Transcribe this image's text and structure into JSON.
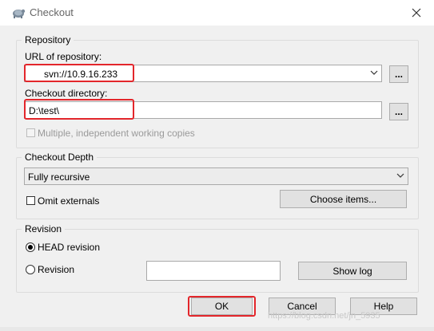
{
  "window": {
    "title": "Checkout",
    "close_icon": "close-icon"
  },
  "repository": {
    "legend": "Repository",
    "url_label": "URL of repository:",
    "url_value": "svn://10.9.16.233",
    "browse_label": "...",
    "checkout_dir_label": "Checkout directory:",
    "checkout_dir_value": "D:\\test\\",
    "checkout_browse_label": "...",
    "multiple_label": "Multiple, independent working copies"
  },
  "depth": {
    "legend": "Checkout Depth",
    "selected": "Fully recursive",
    "omit_externals_label": "Omit externals",
    "choose_items_label": "Choose items..."
  },
  "revision": {
    "legend": "Revision",
    "head_label": "HEAD revision",
    "revision_label": "Revision",
    "revision_value": "",
    "show_log_label": "Show log"
  },
  "footer": {
    "ok_label": "OK",
    "cancel_label": "Cancel",
    "help_label": "Help"
  },
  "watermark": "https://blog.csdn.net/jn_5935",
  "colors": {
    "highlight": "#e3262b",
    "background": "#f0f0f0",
    "button": "#e1e1e1"
  }
}
